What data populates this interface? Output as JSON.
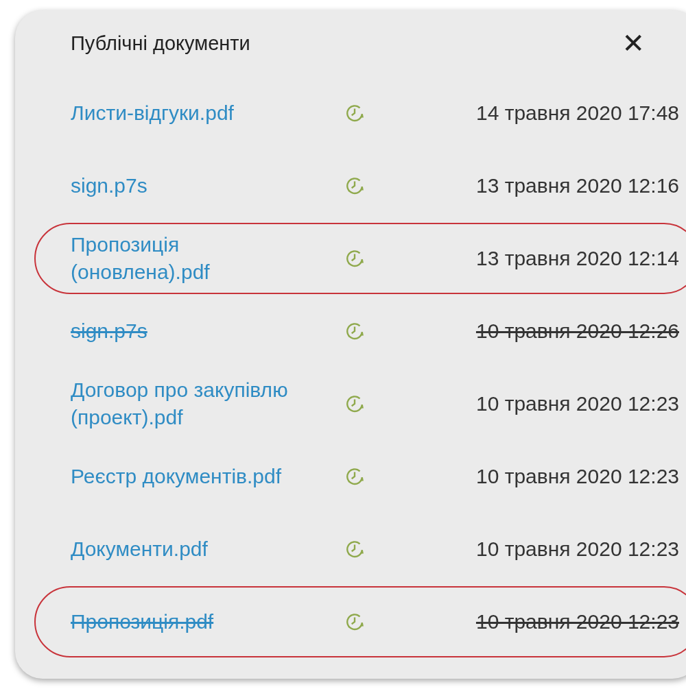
{
  "dialog": {
    "title": "Публічні документи",
    "close": "✕"
  },
  "documents": [
    {
      "name": "Листи-відгуки.pdf",
      "date": "14 травня 2020 17:48",
      "struck": false,
      "highlighted": false
    },
    {
      "name": "sign.p7s",
      "date": "13 травня 2020 12:16",
      "struck": false,
      "highlighted": false
    },
    {
      "name": "Пропозиція (оновлена).pdf",
      "date": "13 травня 2020 12:14",
      "struck": false,
      "highlighted": true
    },
    {
      "name": "sign.p7s",
      "date": "10 травня 2020 12:26",
      "struck": true,
      "highlighted": false
    },
    {
      "name": "Договор про закупівлю (проект).pdf",
      "date": "10 травня 2020 12:23",
      "struck": false,
      "highlighted": false
    },
    {
      "name": "Реєстр документів.pdf",
      "date": "10 травня 2020 12:23",
      "struck": false,
      "highlighted": false
    },
    {
      "name": "Документи.pdf",
      "date": "10 травня 2020 12:23",
      "struck": false,
      "highlighted": false
    },
    {
      "name": "Пропозиція.pdf",
      "date": "10 травня 2020 12:23",
      "struck": true,
      "highlighted": true
    }
  ]
}
